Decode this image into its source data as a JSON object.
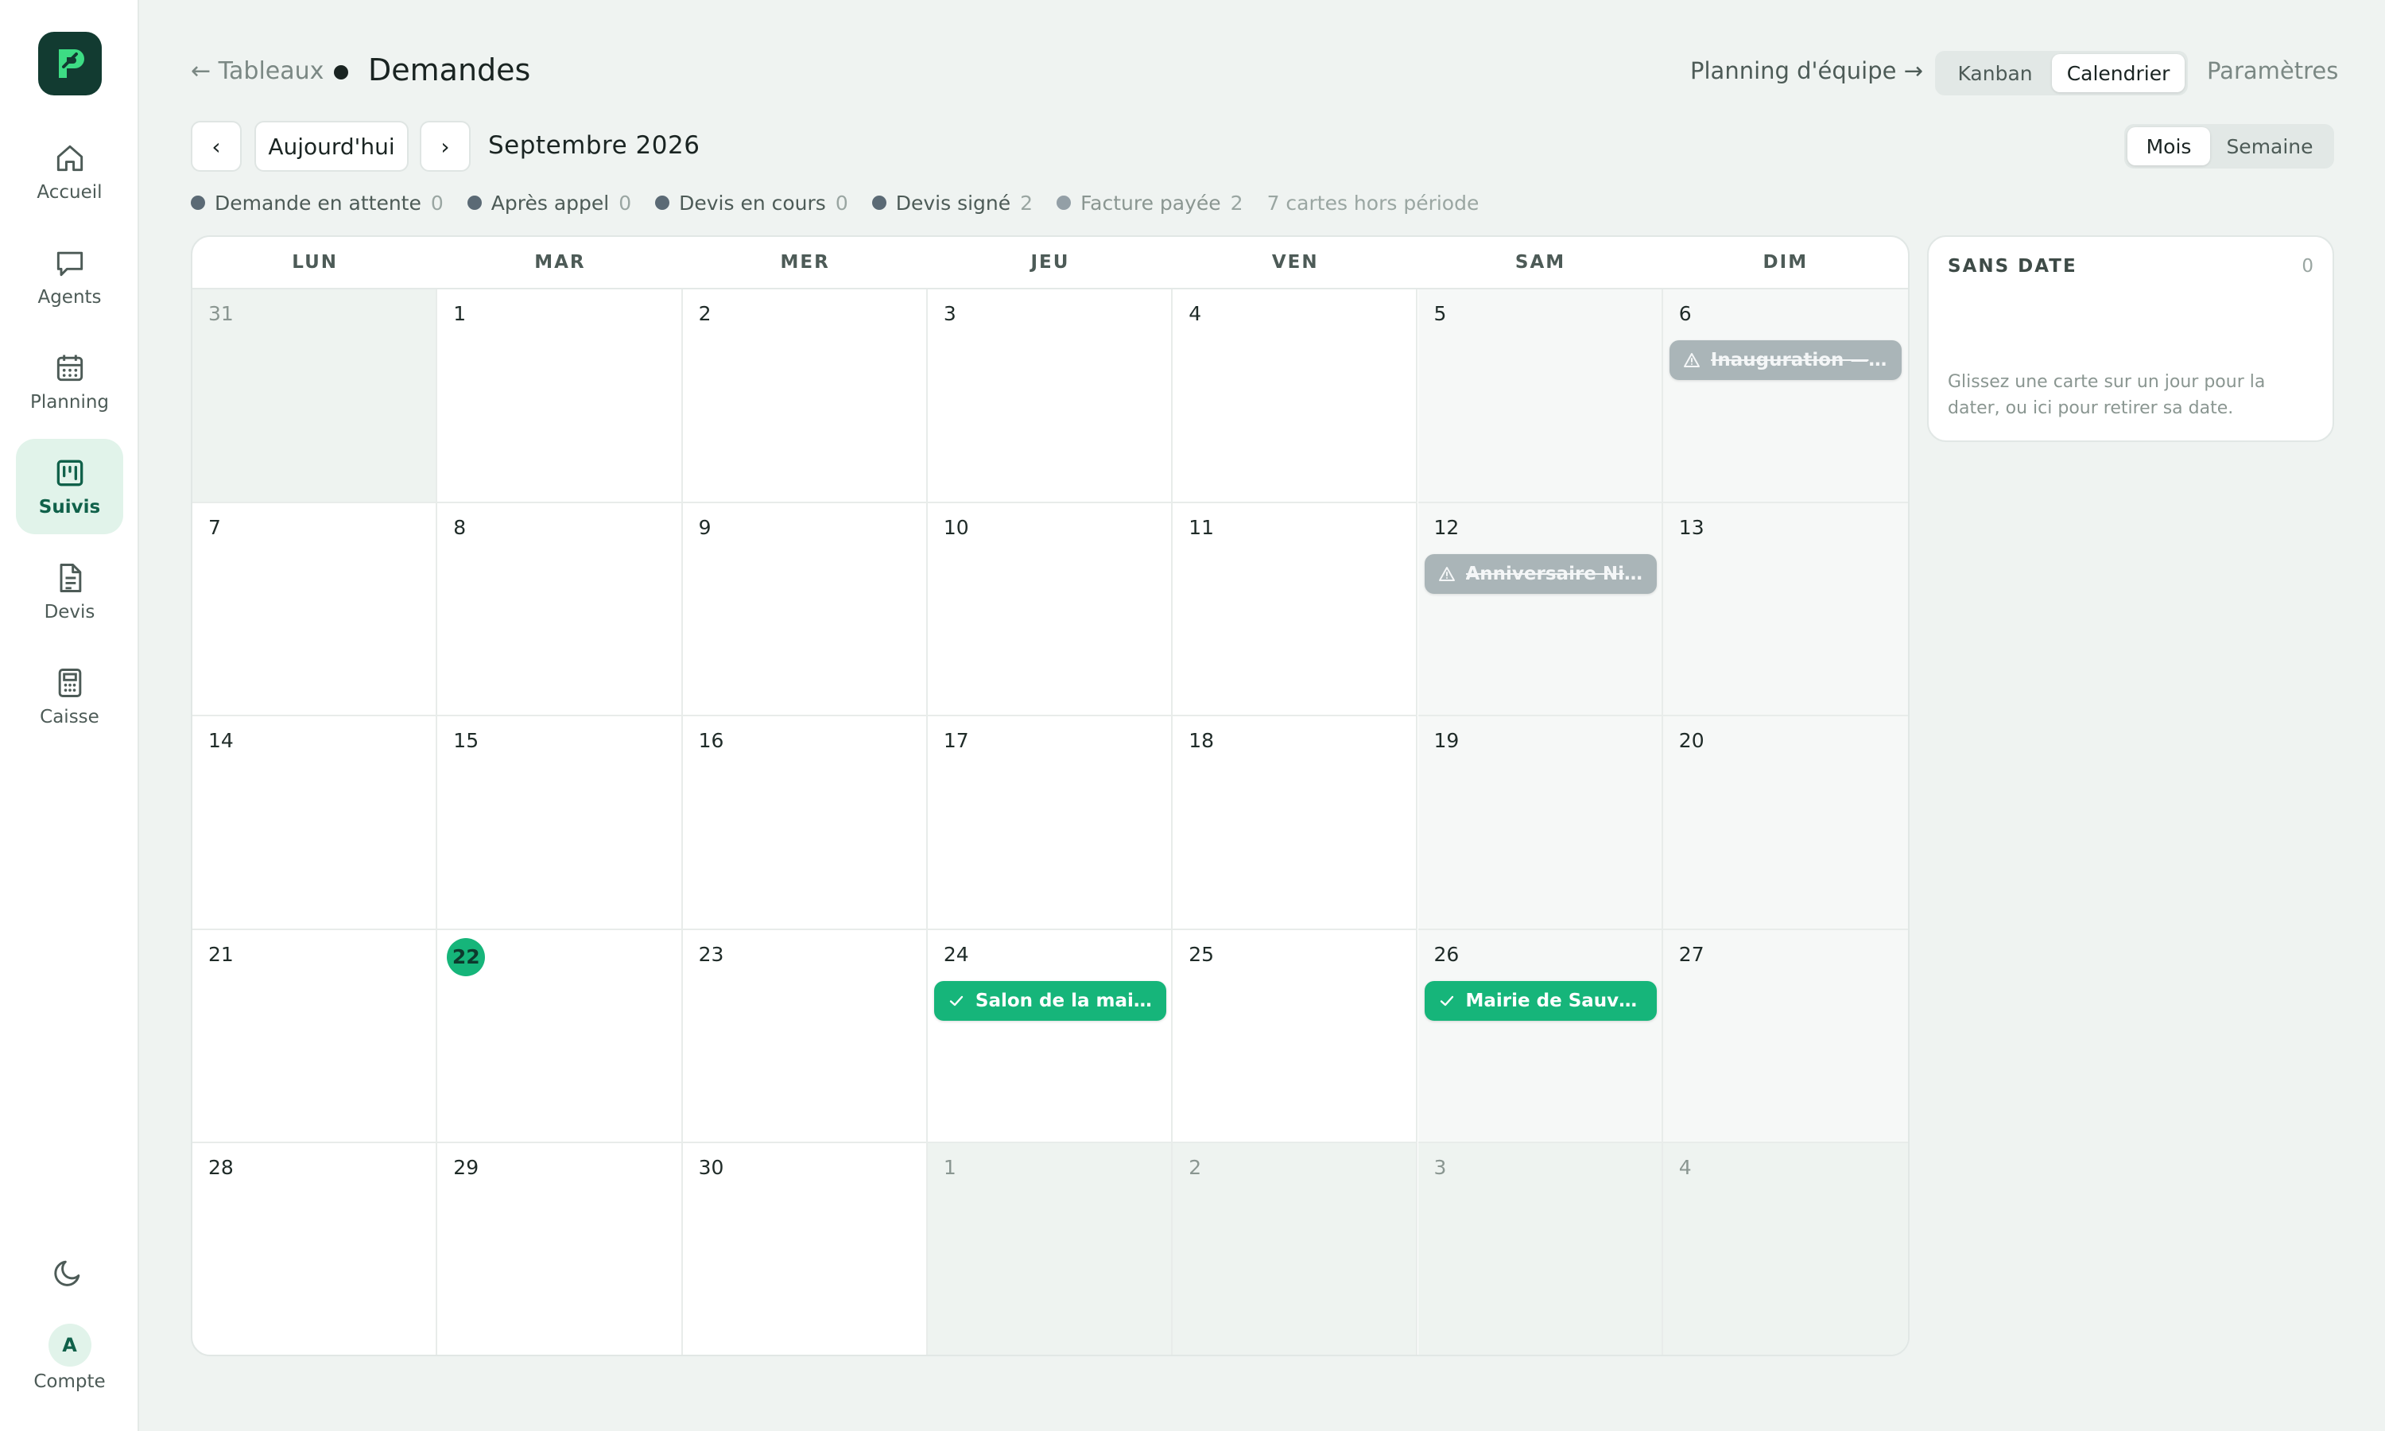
{
  "sidebar": {
    "items": [
      {
        "label": "Accueil",
        "icon": "home-icon"
      },
      {
        "label": "Agents",
        "icon": "chat-icon"
      },
      {
        "label": "Planning",
        "icon": "calendar-icon"
      },
      {
        "label": "Suivis",
        "icon": "kanban-icon",
        "active": true
      },
      {
        "label": "Devis",
        "icon": "document-icon"
      },
      {
        "label": "Caisse",
        "icon": "calculator-icon"
      }
    ],
    "account": {
      "initial": "A",
      "label": "Compte"
    }
  },
  "header": {
    "back_label": "← Tableaux",
    "title": "Demandes",
    "team_link": "Planning d'équipe →",
    "view_options": [
      "Kanban",
      "Calendrier"
    ],
    "active_view": "Calendrier",
    "settings": "Paramètres"
  },
  "navigation": {
    "prev": "‹",
    "today": "Aujourd'hui",
    "next": "›",
    "month": "Septembre 2026",
    "range_options": [
      "Mois",
      "Semaine"
    ],
    "active_range": "Mois"
  },
  "legend": {
    "items": [
      {
        "label": "Demande en attente",
        "count": "0",
        "color": "#5b6a75"
      },
      {
        "label": "Après appel",
        "count": "0",
        "color": "#5b6a75"
      },
      {
        "label": "Devis en cours",
        "count": "0",
        "color": "#5b6a75"
      },
      {
        "label": "Devis signé",
        "count": "2",
        "color": "#5b6a75"
      },
      {
        "label": "Facture payée",
        "count": "2",
        "color": "#939fa6"
      }
    ],
    "extra": "7 cartes hors période"
  },
  "calendar": {
    "weekdays": [
      "LUN",
      "MAR",
      "MER",
      "JEU",
      "VEN",
      "SAM",
      "DIM"
    ],
    "weeks": [
      [
        {
          "d": "31",
          "out": true
        },
        {
          "d": "1"
        },
        {
          "d": "2"
        },
        {
          "d": "3"
        },
        {
          "d": "4"
        },
        {
          "d": "5"
        },
        {
          "d": "6",
          "event": {
            "label": "Inauguration — ...",
            "status": "cancelled"
          }
        }
      ],
      [
        {
          "d": "7"
        },
        {
          "d": "8"
        },
        {
          "d": "9"
        },
        {
          "d": "10"
        },
        {
          "d": "11"
        },
        {
          "d": "12",
          "event": {
            "label": "Anniversaire Ni...",
            "status": "cancelled"
          }
        },
        {
          "d": "13"
        }
      ],
      [
        {
          "d": "14"
        },
        {
          "d": "15"
        },
        {
          "d": "16"
        },
        {
          "d": "17"
        },
        {
          "d": "18"
        },
        {
          "d": "19"
        },
        {
          "d": "20"
        }
      ],
      [
        {
          "d": "21"
        },
        {
          "d": "22",
          "today": true
        },
        {
          "d": "23"
        },
        {
          "d": "24",
          "event": {
            "label": "Salon de la mai...",
            "status": "done"
          }
        },
        {
          "d": "25"
        },
        {
          "d": "26",
          "event": {
            "label": "Mairie de Sauve...",
            "status": "done"
          }
        },
        {
          "d": "27"
        }
      ],
      [
        {
          "d": "28"
        },
        {
          "d": "29"
        },
        {
          "d": "30"
        },
        {
          "d": "1",
          "out": true
        },
        {
          "d": "2",
          "out": true
        },
        {
          "d": "3",
          "out": true
        },
        {
          "d": "4",
          "out": true
        }
      ]
    ]
  },
  "side_panel": {
    "title": "SANS DATE",
    "count": "0",
    "hint": "Glissez une carte sur un jour pour la dater, ou ici pour retirer sa date."
  },
  "colors": {
    "accent": "#16b57a",
    "logo_bg": "#123b31",
    "cancelled": "#aab5b8"
  }
}
